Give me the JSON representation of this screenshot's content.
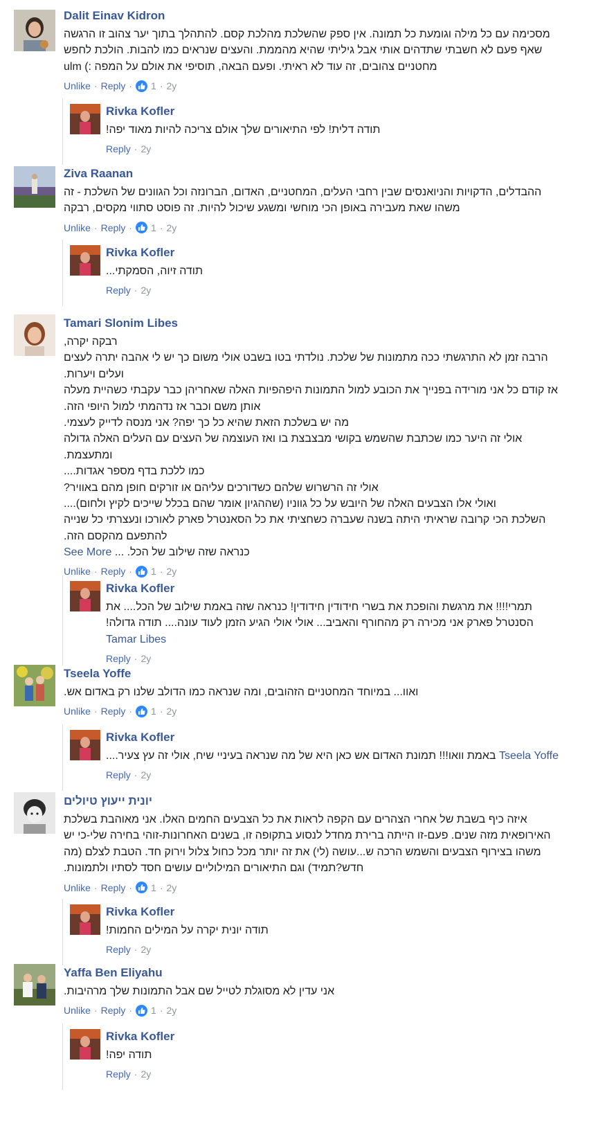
{
  "actions": {
    "unlike": "Unlike",
    "reply": "Reply",
    "sep": "·",
    "like_count": "1",
    "age": "2y"
  },
  "comments": [
    {
      "author": "Dalit Einav Kidron",
      "lines": [
        "מסכימה עם כל מילה וגומעת כל תמונה. אין ספק שהשלכת מהלכת קסם. להתהלך בתוך יער צהוב זו הרגשה",
        "שאף פעם לא חשבתי שתדהים אותי אבל גיליתי שהיא מהממת. והעצים שנראים כמו להבות. הולכת לחפש",
        "מחטניים צהובים, זה עוד לא ראיתי. ופעם הבאה, תוסיפי את אולם על המפה :) ulm"
      ],
      "reply": {
        "author": "Rivka Kofler",
        "lines": [
          "תודה דלית! לפי התיאורים שלך אולם צריכה להיות מאוד יפה!"
        ],
        "age": "2y"
      }
    },
    {
      "author": "Ziva Raanan",
      "lines": [
        "ההבדלים, הדקויות והניואנסים שבין רחבי העלים, המחטניים, האדום, הברונזה וכל הגוונים של השלכת - זה",
        "משהו שאת מעבירה באופן הכי מוחשי ומשגע שיכול להיות. זה פוסט סתווי מקסים, רבקה"
      ],
      "reply": {
        "author": "Rivka Kofler",
        "lines": [
          "תודה זיוה, הסמקתי..."
        ],
        "age": "2y"
      }
    },
    {
      "author": "Tamari Slonim Libes",
      "lines": [
        "רבקה יקרה,",
        "הרבה זמן לא התרגשתי ככה מתמונות של שלכת. נולדתי בטו בשבט אולי משום כך יש לי אהבה יתרה לעצים",
        "ועלים ויערות.",
        "אז קודם כל אני מורידה בפנייך את הכובע למול התמונות היפהפיות האלה שאחריהן כבר עקבתי כשהיית מעלה",
        "אותן משם וכבר אז נדהמתי למול היופי הזה.",
        "מה יש בשלכת הזאת שהיא כל כך יפה? אני מנסה לדייק לעצמי.",
        "אולי זה היער כמו שכתבת שהשמש בקושי מבצבצת בו ואז העוצמה של העצים עם העלים האלה גדולה",
        "ומתעצמת.",
        "כמו ללכת בדף מספר אגדות....",
        "אולי זה הרשרוש שלהם כשדורכים עליהם או זורקים חופן מהם באוויר?",
        "ואולי אלו הצבעים האלה של היובש על כל גווניו (שההגיון אומר שהם בכלל שייכים לקיץ ולחום)....",
        "השלכת הכי קרובה שראיתי היתה בשנה שעברה כשחציתי את כל הסאנטרל פארק לאורכו ונעצרתי כל שנייה",
        "להתפעם מהקסם הזה.",
        "כנראה שזה שילוב של הכל. ..."
      ],
      "see_more": "See More",
      "reply": {
        "author": "Rivka Kofler",
        "lines": [
          "תמרי!!!! את מרגשת והופכת את בשרי חידודין חידודין! כנראה שזה באמת שילוב של הכל.... את",
          "הסנטרל פארק אני מכירה רק מהחורף והאביב... אולי אולי הגיע הזמן לעוד עונה.... תודה גדולה!"
        ],
        "mention": "Tamar Libes",
        "age": "2y"
      }
    },
    {
      "author": "Tseela Yoffe",
      "lines": [
        "ואוו... במיוחד המחטניים הזהובים, ומה שנראה כמו הדולב שלנו רק באדום אש."
      ],
      "reply": {
        "author": "Rivka Kofler",
        "lines": [
          "באמת וואו!!! תמונת האדום אש כאן היא של מה שנראה בעיניי שיח, אולי זה עץ צעיר...."
        ],
        "mention_inline": "Tseela Yoffe",
        "age": "2y"
      }
    },
    {
      "author": "יונית ייעוץ טיולים",
      "lines": [
        "איזה כיף בשבת של אחרי הצהרים עם הקפה לראות את כל הצבעים החמים האלו. אני מאוהבת בשלכת",
        "האירופאית מזה שנים. פעם-זו הייתה ברירת מחדל לנסוע בתקופה זו, בשנים האחרונות-זוהי בחירה שלי-כי יש",
        "משהו בצירוף הצבעים והשמש הרכה ש...עושה (לי) את זה יותר מכל כחול צלול וירוק חד. הטבת לצלם (מה",
        "חדש?תמיד) וגם התיאורים המילוליים עושים חסד לסתיו ולתמונות."
      ],
      "reply": {
        "author": "Rivka Kofler",
        "lines": [
          "תודה יונית יקרה על המילים החמות!"
        ],
        "age": "2y"
      }
    },
    {
      "author": "Yaffa Ben Eliyahu",
      "lines": [
        "אני עדין לא מסוגלת לטייל שם אבל התמונות שלך מרהיבות."
      ],
      "reply": {
        "author": "Rivka Kofler",
        "lines": [
          "תודה יפה!"
        ],
        "age": "2y"
      }
    }
  ]
}
